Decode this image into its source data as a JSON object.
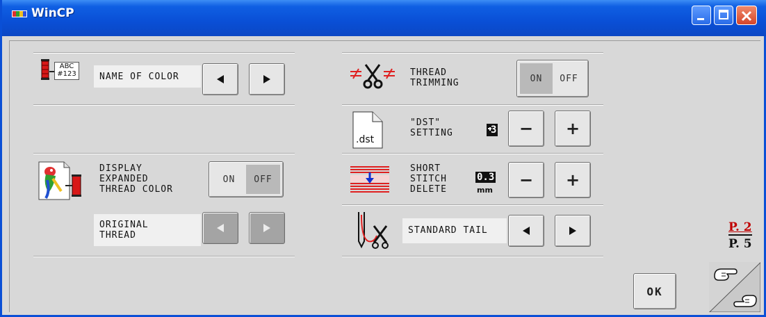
{
  "window": {
    "title": "WinCP"
  },
  "left": {
    "name_of_color": {
      "label": "NAME OF COLOR",
      "icon_text_1": "ABC",
      "icon_text_2": "#123"
    },
    "display_expanded": {
      "label_1": "DISPLAY",
      "label_2": "EXPANDED",
      "label_3": "THREAD COLOR",
      "on": "ON",
      "off": "OFF",
      "active": "OFF"
    },
    "original_thread": {
      "label_1": "ORIGINAL",
      "label_2": "THREAD"
    }
  },
  "right": {
    "thread_trimming": {
      "label_1": "THREAD",
      "label_2": "TRIMMING",
      "on": "ON",
      "off": "OFF",
      "active": "ON"
    },
    "dst_setting": {
      "label_1": "\"DST\"",
      "label_2": "SETTING",
      "value": "3",
      "minus": "−",
      "plus": "+",
      "file_text": ".dst"
    },
    "short_stitch_delete": {
      "label_1": "SHORT",
      "label_2": "STITCH",
      "label_3": "DELETE",
      "value": "0.3",
      "unit": "mm",
      "minus": "−",
      "plus": "+"
    },
    "standard_tail": {
      "label": "STANDARD TAIL"
    }
  },
  "pager": {
    "current": "P. 2",
    "total": "P. 5"
  },
  "ok_label": "OK",
  "colors": {
    "title_bar": "#0a4fd6",
    "page_number": "#c00000",
    "thread_red": "#d01010"
  }
}
